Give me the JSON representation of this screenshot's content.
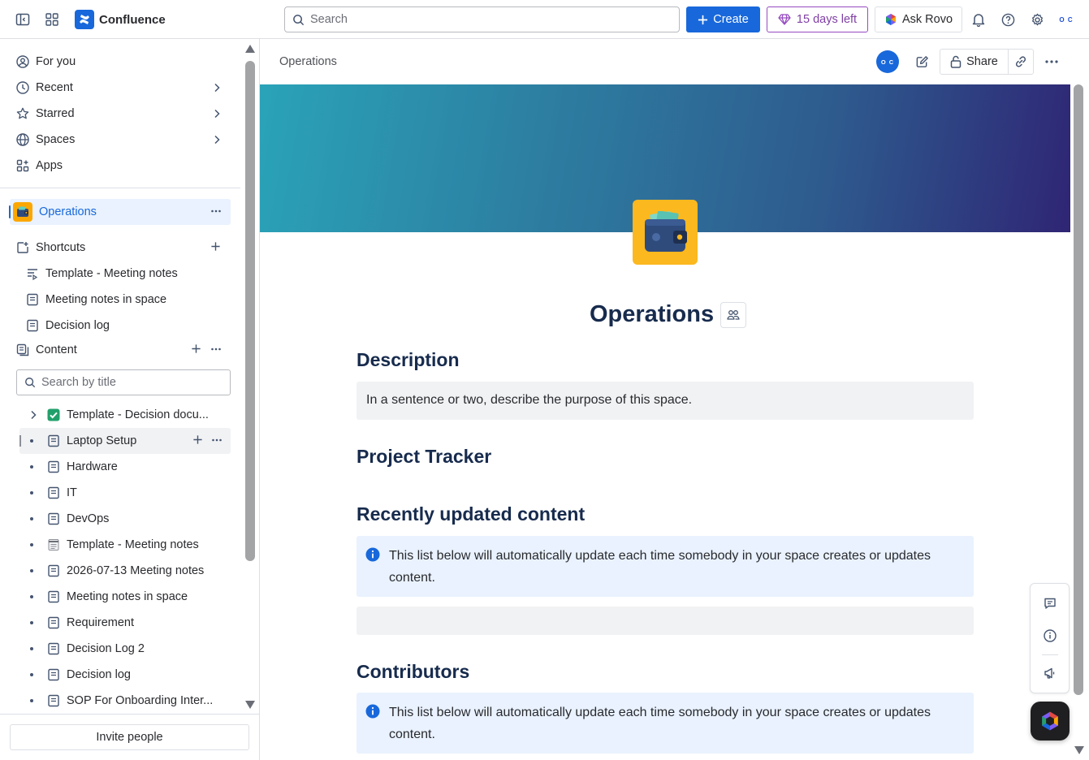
{
  "app": {
    "name": "Confluence"
  },
  "topbar": {
    "search_placeholder": "Search",
    "create_label": "Create",
    "trial_label": "15 days left",
    "rovo_label": "Ask Rovo",
    "avatar_initials": "O C"
  },
  "sidebar": {
    "nav": [
      {
        "label": "For you"
      },
      {
        "label": "Recent"
      },
      {
        "label": "Starred"
      },
      {
        "label": "Spaces"
      },
      {
        "label": "Apps"
      }
    ],
    "space": {
      "label": "Operations"
    },
    "shortcuts": {
      "header": "Shortcuts",
      "items": [
        {
          "label": "Template - Meeting notes"
        },
        {
          "label": "Meeting notes in space"
        },
        {
          "label": "Decision log"
        }
      ]
    },
    "content": {
      "header": "Content",
      "filter_placeholder": "Search by title",
      "items": [
        {
          "label": "Template - Decision docu..."
        },
        {
          "label": "Laptop Setup"
        },
        {
          "label": "Hardware"
        },
        {
          "label": "IT"
        },
        {
          "label": "DevOps"
        },
        {
          "label": "Template - Meeting notes"
        },
        {
          "label": "2026-07-13 Meeting notes"
        },
        {
          "label": "Meeting notes in space"
        },
        {
          "label": "Requirement"
        },
        {
          "label": "Decision Log 2"
        },
        {
          "label": "Decision log"
        },
        {
          "label": "SOP For Onboarding Inter..."
        }
      ]
    },
    "invite_label": "Invite people"
  },
  "page": {
    "breadcrumb": "Operations",
    "avatar_initials": "O C",
    "share_label": "Share",
    "title": "Operations",
    "sections": {
      "description": {
        "heading": "Description",
        "text": "In a sentence or two, describe the purpose of this space."
      },
      "tracker": {
        "heading": "Project Tracker"
      },
      "recent": {
        "heading": "Recently updated content",
        "info": "This list below will automatically update each time somebody in your space creates or updates content."
      },
      "contributors": {
        "heading": "Contributors",
        "info": "This list below will automatically update each time somebody in your space creates or updates content."
      }
    }
  },
  "colors": {
    "brand": "#1868db",
    "trial": "#803fa5",
    "banner_start": "#2aa3b8",
    "banner_end": "#2f2574",
    "emoji_bg": "#fcb81f",
    "info_bg": "#e9f2fe"
  },
  "icons": [
    "sidebar-toggle-icon",
    "app-switcher-icon",
    "confluence-logo-icon",
    "search-icon",
    "plus-icon",
    "gem-icon",
    "rovo-icon",
    "bell-icon",
    "help-icon",
    "gear-icon",
    "user-circle-icon",
    "clock-icon",
    "star-icon",
    "globe-icon",
    "apps-icon",
    "more-icon",
    "shortcut-icon",
    "page-icon",
    "chevron-right-icon",
    "edit-icon",
    "lock-icon",
    "link-icon",
    "info-icon",
    "comment-icon",
    "megaphone-icon",
    "wallet-icon"
  ]
}
